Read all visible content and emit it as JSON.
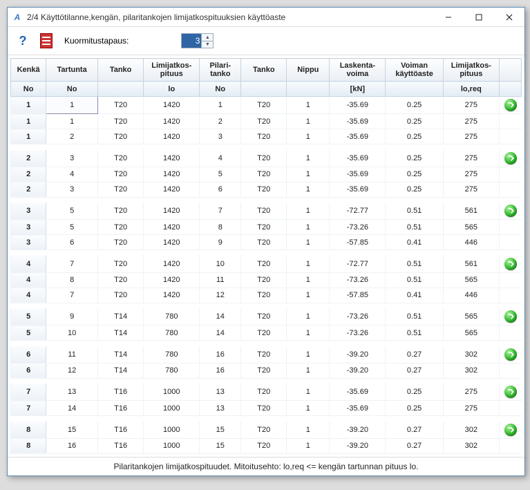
{
  "titlebar": {
    "icon_letter": "A",
    "title": "2/4 Käyttötilanne,kengän, pilaritankojen limijatkospituuksien käyttöaste"
  },
  "toolbar": {
    "load_case_label": "Kuormitustapaus:",
    "load_case_value": "3"
  },
  "headers": {
    "kenka": "Kenkä",
    "tartunta": "Tartunta",
    "tanko1": "Tanko",
    "limijatkos_pituus": "Limijatkos- pituus",
    "pilari_tanko": "Pilari- tanko",
    "tanko2": "Tanko",
    "nippu": "Nippu",
    "laskenta_voima": "Laskenta- voima",
    "voiman_kayttoaste": "Voiman käyttöaste",
    "limijatkos_pituus_req": "Limijatkos- pituus"
  },
  "subheaders": {
    "no1": "No",
    "no2": "No",
    "lo": "lo",
    "no3": "No",
    "kn": "[kN]",
    "loreq": "lo,req"
  },
  "groups": [
    [
      {
        "kenka": "1",
        "tartunta": "1",
        "tanko1": "T20",
        "lo": "1420",
        "pilari": "1",
        "tanko2": "T20",
        "nippu": "1",
        "voima": "-35.69",
        "kaytto": "0.25",
        "loreq": "275",
        "orb": true,
        "sel": true
      },
      {
        "kenka": "1",
        "tartunta": "1",
        "tanko1": "T20",
        "lo": "1420",
        "pilari": "2",
        "tanko2": "T20",
        "nippu": "1",
        "voima": "-35.69",
        "kaytto": "0.25",
        "loreq": "275",
        "orb": false
      },
      {
        "kenka": "1",
        "tartunta": "2",
        "tanko1": "T20",
        "lo": "1420",
        "pilari": "3",
        "tanko2": "T20",
        "nippu": "1",
        "voima": "-35.69",
        "kaytto": "0.25",
        "loreq": "275",
        "orb": false
      }
    ],
    [
      {
        "kenka": "2",
        "tartunta": "3",
        "tanko1": "T20",
        "lo": "1420",
        "pilari": "4",
        "tanko2": "T20",
        "nippu": "1",
        "voima": "-35.69",
        "kaytto": "0.25",
        "loreq": "275",
        "orb": true
      },
      {
        "kenka": "2",
        "tartunta": "4",
        "tanko1": "T20",
        "lo": "1420",
        "pilari": "5",
        "tanko2": "T20",
        "nippu": "1",
        "voima": "-35.69",
        "kaytto": "0.25",
        "loreq": "275",
        "orb": false
      },
      {
        "kenka": "2",
        "tartunta": "3",
        "tanko1": "T20",
        "lo": "1420",
        "pilari": "6",
        "tanko2": "T20",
        "nippu": "1",
        "voima": "-35.69",
        "kaytto": "0.25",
        "loreq": "275",
        "orb": false
      }
    ],
    [
      {
        "kenka": "3",
        "tartunta": "5",
        "tanko1": "T20",
        "lo": "1420",
        "pilari": "7",
        "tanko2": "T20",
        "nippu": "1",
        "voima": "-72.77",
        "kaytto": "0.51",
        "loreq": "561",
        "orb": true
      },
      {
        "kenka": "3",
        "tartunta": "5",
        "tanko1": "T20",
        "lo": "1420",
        "pilari": "8",
        "tanko2": "T20",
        "nippu": "1",
        "voima": "-73.26",
        "kaytto": "0.51",
        "loreq": "565",
        "orb": false
      },
      {
        "kenka": "3",
        "tartunta": "6",
        "tanko1": "T20",
        "lo": "1420",
        "pilari": "9",
        "tanko2": "T20",
        "nippu": "1",
        "voima": "-57.85",
        "kaytto": "0.41",
        "loreq": "446",
        "orb": false
      }
    ],
    [
      {
        "kenka": "4",
        "tartunta": "7",
        "tanko1": "T20",
        "lo": "1420",
        "pilari": "10",
        "tanko2": "T20",
        "nippu": "1",
        "voima": "-72.77",
        "kaytto": "0.51",
        "loreq": "561",
        "orb": true
      },
      {
        "kenka": "4",
        "tartunta": "8",
        "tanko1": "T20",
        "lo": "1420",
        "pilari": "11",
        "tanko2": "T20",
        "nippu": "1",
        "voima": "-73.26",
        "kaytto": "0.51",
        "loreq": "565",
        "orb": false
      },
      {
        "kenka": "4",
        "tartunta": "7",
        "tanko1": "T20",
        "lo": "1420",
        "pilari": "12",
        "tanko2": "T20",
        "nippu": "1",
        "voima": "-57.85",
        "kaytto": "0.41",
        "loreq": "446",
        "orb": false
      }
    ],
    [
      {
        "kenka": "5",
        "tartunta": "9",
        "tanko1": "T14",
        "lo": "780",
        "pilari": "14",
        "tanko2": "T20",
        "nippu": "1",
        "voima": "-73.26",
        "kaytto": "0.51",
        "loreq": "565",
        "orb": true
      },
      {
        "kenka": "5",
        "tartunta": "10",
        "tanko1": "T14",
        "lo": "780",
        "pilari": "14",
        "tanko2": "T20",
        "nippu": "1",
        "voima": "-73.26",
        "kaytto": "0.51",
        "loreq": "565",
        "orb": false
      }
    ],
    [
      {
        "kenka": "6",
        "tartunta": "11",
        "tanko1": "T14",
        "lo": "780",
        "pilari": "16",
        "tanko2": "T20",
        "nippu": "1",
        "voima": "-39.20",
        "kaytto": "0.27",
        "loreq": "302",
        "orb": true
      },
      {
        "kenka": "6",
        "tartunta": "12",
        "tanko1": "T14",
        "lo": "780",
        "pilari": "16",
        "tanko2": "T20",
        "nippu": "1",
        "voima": "-39.20",
        "kaytto": "0.27",
        "loreq": "302",
        "orb": false
      }
    ],
    [
      {
        "kenka": "7",
        "tartunta": "13",
        "tanko1": "T16",
        "lo": "1000",
        "pilari": "13",
        "tanko2": "T20",
        "nippu": "1",
        "voima": "-35.69",
        "kaytto": "0.25",
        "loreq": "275",
        "orb": true
      },
      {
        "kenka": "7",
        "tartunta": "14",
        "tanko1": "T16",
        "lo": "1000",
        "pilari": "13",
        "tanko2": "T20",
        "nippu": "1",
        "voima": "-35.69",
        "kaytto": "0.25",
        "loreq": "275",
        "orb": false
      }
    ],
    [
      {
        "kenka": "8",
        "tartunta": "15",
        "tanko1": "T16",
        "lo": "1000",
        "pilari": "15",
        "tanko2": "T20",
        "nippu": "1",
        "voima": "-39.20",
        "kaytto": "0.27",
        "loreq": "302",
        "orb": true
      },
      {
        "kenka": "8",
        "tartunta": "16",
        "tanko1": "T16",
        "lo": "1000",
        "pilari": "15",
        "tanko2": "T20",
        "nippu": "1",
        "voima": "-39.20",
        "kaytto": "0.27",
        "loreq": "302",
        "orb": false
      }
    ]
  ],
  "footer": "Pilaritankojen limijatkospituudet. Mitoitusehto: lo,req <= kengän tartunnan pituus lo."
}
